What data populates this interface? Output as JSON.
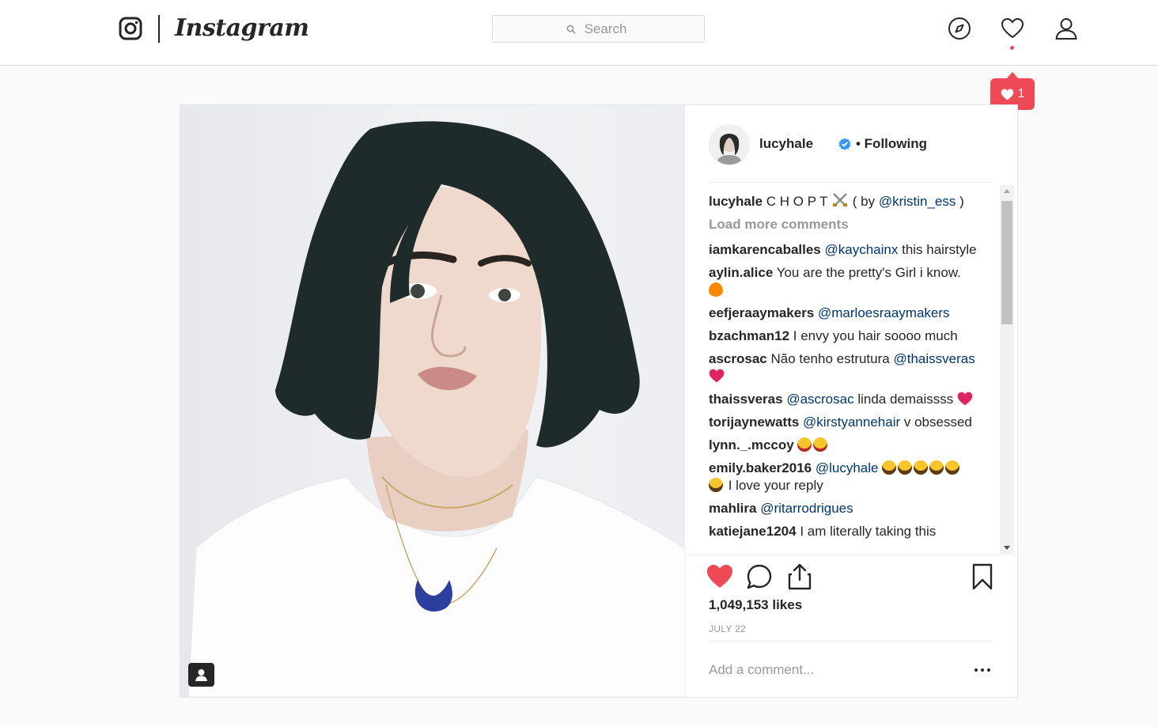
{
  "brand": {
    "wordmark": "Instagram"
  },
  "search": {
    "placeholder": "Search"
  },
  "nav": {
    "icons": [
      "compass-icon",
      "heart-icon",
      "profile-icon"
    ],
    "notification_count": "1",
    "accent": "#ed4956"
  },
  "post": {
    "author": "lucyhale",
    "follow_status": "• Following",
    "caption": {
      "user": "lucyhale",
      "text_before": "C H O P T",
      "text_mid": "( by",
      "mention": "@kristin_ess",
      "text_after": ")"
    },
    "load_more": "Load more comments",
    "comments": [
      {
        "user": "iamkarencaballes",
        "mention": "@kaychainx",
        "text": "this hairstyle"
      },
      {
        "user": "aylin.alice",
        "mention": "",
        "text": "You are the pretty's Girl i know."
      },
      {
        "user": "eefjeraaymakers",
        "mention": "@marloesraaymakers",
        "text": ""
      },
      {
        "user": "bzachman12",
        "mention": "",
        "text": "I envy you hair soooo much"
      },
      {
        "user": "ascrosac",
        "mention": "@thaissveras",
        "text": "Não tenho estrutura"
      },
      {
        "user": "thaissveras",
        "mention": "@ascrosac",
        "text": "linda demaissss"
      },
      {
        "user": "torijaynewatts",
        "mention": "@kirstyannehair",
        "text": "v obsessed"
      },
      {
        "user": "lynn._.mccoy",
        "mention": "",
        "text": ""
      },
      {
        "user": "emily.baker2016",
        "mention": "@lucyhale",
        "text": "I love your reply"
      },
      {
        "user": "mahlira",
        "mention": "@ritarrodrigues",
        "text": ""
      },
      {
        "user": "katiejane1204",
        "mention": "",
        "text": "I am literally taking this"
      }
    ],
    "likes": "1,049,153 likes",
    "date": "JULY 22",
    "add_comment_placeholder": "Add a comment...",
    "colors": {
      "like_red": "#ed4956",
      "mention_blue": "#003569",
      "verified_blue": "#3897f0"
    }
  }
}
